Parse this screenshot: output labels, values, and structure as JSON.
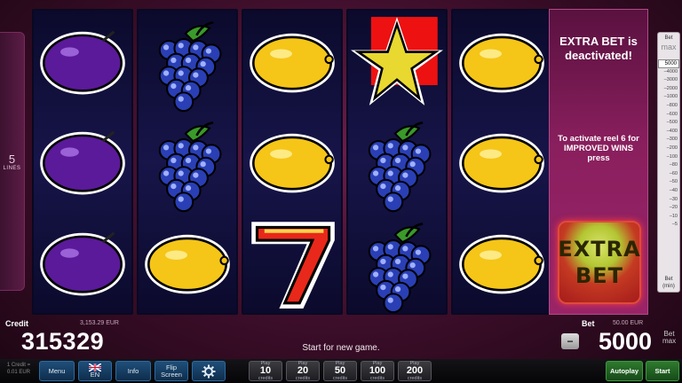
{
  "lines": {
    "count": "5",
    "label": "LINES"
  },
  "reels": [
    [
      "plum",
      "plum",
      "plum"
    ],
    [
      "grapes",
      "grapes",
      "lemon"
    ],
    [
      "lemon",
      "lemon",
      "seven"
    ],
    [
      "star",
      "grapes",
      "grapes"
    ],
    [
      "lemon",
      "lemon",
      "lemon"
    ]
  ],
  "extra_bet": {
    "status": "EXTRA BET is deactivated!",
    "info": "To activate reel 6 for IMPROVED WINS press",
    "button_line1": "EXTRA",
    "button_line2": "BET"
  },
  "bet_slider": {
    "top_label": "Bet",
    "top_max": "max",
    "values": [
      "5000",
      "4000",
      "3000",
      "2000",
      "1000",
      "800",
      "600",
      "500",
      "400",
      "300",
      "200",
      "100",
      "80",
      "60",
      "50",
      "40",
      "30",
      "20",
      "10",
      "5"
    ],
    "selected": "5000",
    "bottom_label": "Bet",
    "bottom_min": "(min)"
  },
  "credit": {
    "label": "Credit",
    "eur": "3,153.29 EUR",
    "value": "315329"
  },
  "status_message": "Start for new game.",
  "bet": {
    "label": "Bet",
    "eur": "50.00 EUR",
    "value": "5000",
    "minus": "−",
    "max_line1": "Bet",
    "max_line2": "max"
  },
  "toolbar": {
    "rate": "1 Credit = 0.01 EUR",
    "menu": "Menu",
    "lang": "EN",
    "info": "Info",
    "flip": "Flip Screen",
    "play_prefix": "Play",
    "play_suffix": "credits",
    "play_options": [
      "10",
      "20",
      "50",
      "100",
      "200"
    ],
    "autoplay": "Autoplay",
    "start": "Start"
  },
  "colors": {
    "plum": "#5a1a9a",
    "grape": "#2a3fb5",
    "lemon": "#f5c518",
    "star": "#e8d830",
    "accent_green": "#2f7a2f"
  }
}
